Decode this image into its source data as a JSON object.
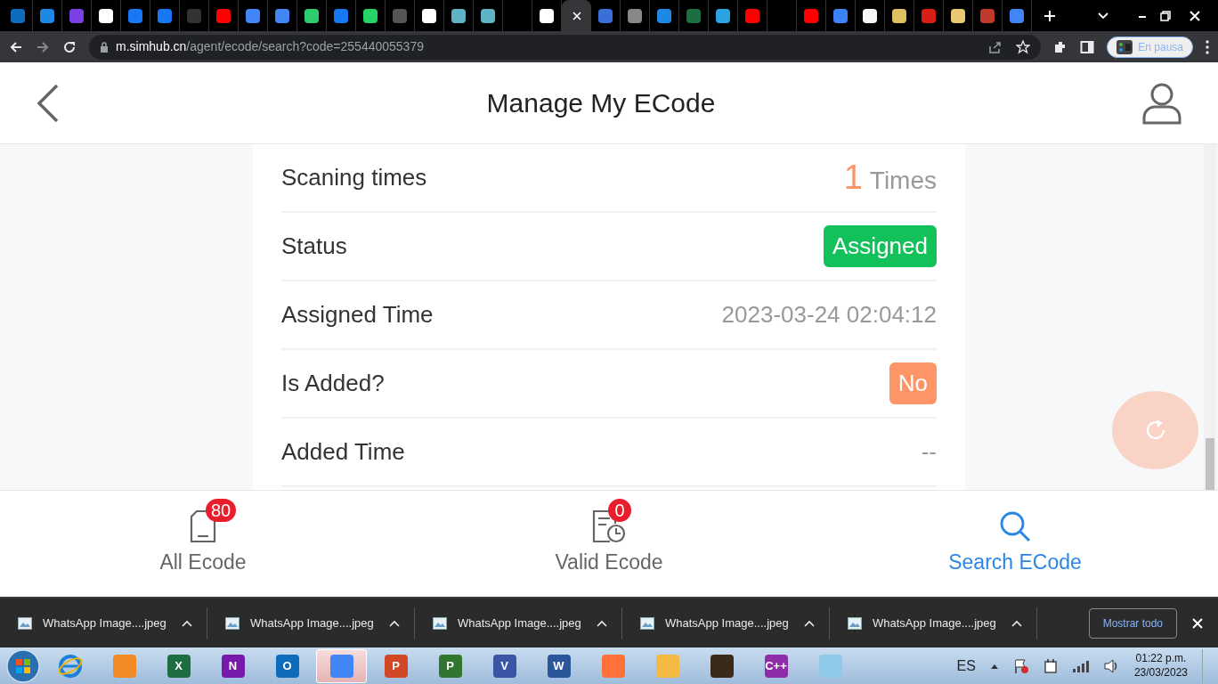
{
  "browser": {
    "tabs": [
      {
        "color": "#0f6cbd",
        "selected": false
      },
      {
        "color": "#1e88e5",
        "selected": false
      },
      {
        "color": "#7b3fe4",
        "selected": false
      },
      {
        "color": "#ffffff",
        "selected": false
      },
      {
        "color": "#1877f2",
        "selected": false
      },
      {
        "color": "#1877f2",
        "selected": false
      },
      {
        "color": "#333333",
        "selected": false
      },
      {
        "color": "#ff0000",
        "selected": false
      },
      {
        "color": "#4285f4",
        "selected": false
      },
      {
        "color": "#4285f4",
        "selected": false
      },
      {
        "color": "#2ecc71",
        "selected": false
      },
      {
        "color": "#1877f2",
        "selected": false
      },
      {
        "color": "#25d366",
        "selected": false
      },
      {
        "color": "#555555",
        "selected": false
      },
      {
        "color": "#ffffff",
        "selected": false
      },
      {
        "color": "#5fb3c6",
        "selected": false
      },
      {
        "color": "#5fb3c6",
        "selected": false
      },
      {
        "selected": false
      },
      {
        "color": "#ffffff",
        "selected": false
      },
      {
        "selected": true
      },
      {
        "color": "#3b6fd8",
        "selected": false
      },
      {
        "color": "#888888",
        "selected": false
      },
      {
        "color": "#1e88e5",
        "selected": false
      },
      {
        "color": "#1d6f42",
        "selected": false
      },
      {
        "color": "#2aa3e0",
        "selected": false
      },
      {
        "color": "#ff0000",
        "selected": false
      },
      {
        "selected": false
      },
      {
        "color": "#ff0000",
        "selected": false
      },
      {
        "color": "#3b82f6",
        "selected": false
      },
      {
        "color": "#f5f5f5",
        "selected": false
      },
      {
        "color": "#e0c060",
        "selected": false
      },
      {
        "color": "#d91e18",
        "selected": false
      },
      {
        "color": "#e8c870",
        "selected": false
      },
      {
        "color": "#c0392b",
        "selected": false
      },
      {
        "color": "#4285f4",
        "selected": false
      }
    ],
    "url_host": "m.simhub.cn",
    "url_path": "/agent/ecode/search?code=255440055379",
    "profile_label": "En pausa"
  },
  "page": {
    "title": "Manage My ECode",
    "rows": [
      {
        "label": "Scaning times",
        "kind": "count",
        "value": "1",
        "unit": "Times"
      },
      {
        "label": "Status",
        "kind": "badge",
        "value": "Assigned",
        "color": "#12c15a"
      },
      {
        "label": "Assigned Time",
        "kind": "text",
        "value": "2023-03-24 02:04:12"
      },
      {
        "label": "Is Added?",
        "kind": "badge",
        "value": "No",
        "color": "#fd9566"
      },
      {
        "label": "Added Time",
        "kind": "text",
        "value": "--"
      }
    ]
  },
  "bottom_nav": [
    {
      "label": "All Ecode",
      "badge": "80",
      "selected": false
    },
    {
      "label": "Valid Ecode",
      "badge": "0",
      "selected": false
    },
    {
      "label": "Search ECode",
      "selected": true
    }
  ],
  "downloads": {
    "items": [
      "WhatsApp Image....jpeg",
      "WhatsApp Image....jpeg",
      "WhatsApp Image....jpeg",
      "WhatsApp Image....jpeg",
      "WhatsApp Image....jpeg"
    ],
    "show_all": "Mostrar todo"
  },
  "taskbar": {
    "apps": [
      {
        "color": "#f08a24",
        "selected": false
      },
      {
        "color": "#1d6f42",
        "glyph": "X",
        "selected": false
      },
      {
        "color": "#7719aa",
        "glyph": "N",
        "selected": false
      },
      {
        "color": "#0f6cbd",
        "glyph": "O",
        "selected": false
      },
      {
        "color": "#4285f4",
        "selected": true
      },
      {
        "color": "#d24726",
        "glyph": "P",
        "selected": false
      },
      {
        "color": "#31752f",
        "glyph": "P",
        "selected": false
      },
      {
        "color": "#3955a3",
        "glyph": "V",
        "selected": false
      },
      {
        "color": "#2b579a",
        "glyph": "W",
        "selected": false
      },
      {
        "color": "#ff7139",
        "selected": false
      },
      {
        "color": "#f4b942",
        "selected": false
      },
      {
        "color": "#3a2a1a",
        "selected": false
      },
      {
        "color": "#8e2da8",
        "glyph": "C++",
        "selected": false
      },
      {
        "color": "#8fc9e8",
        "selected": false
      }
    ],
    "language": "ES",
    "time": "01:22 p.m.",
    "date": "23/03/2023"
  }
}
